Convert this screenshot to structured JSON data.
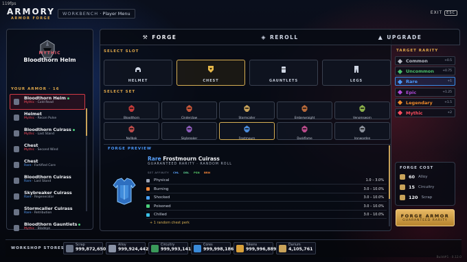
{
  "fps": "119fps",
  "app": {
    "title": "ARMORY",
    "subtitle": "ARMOR FORGE",
    "breadcrumb_root": "WORKBENCH",
    "breadcrumb_sep": "·",
    "breadcrumb_page": "Player Menu",
    "exit_label": "EXIT",
    "exit_key": "ESC"
  },
  "selected_item": {
    "rarity": "MYTHIC",
    "name": "Bloodthorn Helm",
    "icon": "helmet-icon"
  },
  "your_armor": {
    "label": "YOUR ARMOR · 16",
    "items": [
      {
        "name": "Bloodthorn Helm",
        "rarity": "Mythic",
        "perk": "Cold Read",
        "equipped": true,
        "selected": true
      },
      {
        "name": "Helmet",
        "rarity": "Mythic",
        "perk": "Recon Pulse",
        "equipped": false,
        "selected": false
      },
      {
        "name": "Bloodthorn Cuirass",
        "rarity": "Mythic",
        "perk": "Last Stand",
        "equipped": true,
        "selected": false
      },
      {
        "name": "Chest",
        "rarity": "Mythic",
        "perk": "Second Wind",
        "equipped": false,
        "selected": false
      },
      {
        "name": "Chest",
        "rarity": "Rare",
        "perk": "Fortified Core",
        "equipped": false,
        "selected": false
      },
      {
        "name": "Bloodthorn Cuirass",
        "rarity": "Rare",
        "perk": "Last Stand",
        "equipped": false,
        "selected": false
      },
      {
        "name": "Skybreaker Cuirass",
        "rarity": "Rare",
        "perk": "Regenerator",
        "equipped": false,
        "selected": false
      },
      {
        "name": "Stormcaller Cuirass",
        "rarity": "Rare",
        "perk": "Retribution",
        "equipped": false,
        "selected": false
      },
      {
        "name": "Bloodthorn Gauntlets",
        "rarity": "Mythic",
        "perk": "Bladeye",
        "equipped": true,
        "selected": false
      }
    ]
  },
  "tabs": [
    {
      "label": "FORGE",
      "icon": "hammer-icon",
      "active": true
    },
    {
      "label": "REROLL",
      "icon": "cube-icon",
      "active": false
    },
    {
      "label": "UPGRADE",
      "icon": "arrow-up-icon",
      "active": false
    }
  ],
  "select_slot": {
    "label": "SELECT SLOT",
    "slots": [
      {
        "label": "HELMET",
        "icon": "helmet-icon",
        "selected": false
      },
      {
        "label": "CHEST",
        "icon": "chest-icon",
        "selected": true
      },
      {
        "label": "GAUNTLETS",
        "icon": "gauntlets-icon",
        "selected": false
      },
      {
        "label": "LEGS",
        "icon": "legs-icon",
        "selected": false
      }
    ]
  },
  "select_set": {
    "label": "SELECT SET",
    "sets": [
      {
        "label": "Bloodthorn",
        "color": "#c23a3a",
        "selected": false
      },
      {
        "label": "Cinderclaw",
        "color": "#c7573a",
        "selected": false
      },
      {
        "label": "Stormcaller",
        "color": "#c9a35a",
        "selected": false
      },
      {
        "label": "Emberwraight",
        "color": "#b86a3a",
        "selected": false
      },
      {
        "label": "Venomsworn",
        "color": "#8bb04a",
        "selected": false
      },
      {
        "label": "Nullbak",
        "color": "#b84a4a",
        "selected": false
      },
      {
        "label": "Skybreaker",
        "color": "#8a5ab8",
        "selected": false
      },
      {
        "label": "Frostmourn",
        "color": "#4a8ad8",
        "selected": true
      },
      {
        "label": "Duskflame",
        "color": "#b84a8a",
        "selected": false
      },
      {
        "label": "Ironwarden",
        "color": "#8a8f9a",
        "selected": false
      }
    ]
  },
  "forge_preview": {
    "label": "FORGE PREVIEW",
    "rarity": "Rare",
    "name": "Frostmourn Cuirass",
    "guarantee": "GUARANTEED RARITY · RANDOM ROLL",
    "affinity_label": "SET AFFINITY",
    "affinities": [
      {
        "code": "CHL",
        "color": "#5aa3ff"
      },
      {
        "code": "DBL",
        "color": "#58c48a"
      },
      {
        "code": "PSN",
        "color": "#5ad06a"
      },
      {
        "code": "BRN",
        "color": "#ff8a3a"
      }
    ],
    "stats": [
      {
        "label": "Physical",
        "range": "1.0 – 3.0%",
        "color": "#9aa3b5"
      },
      {
        "label": "Burning",
        "range": "3.0 – 10.0%",
        "color": "#ff8a3a"
      },
      {
        "label": "Shocked",
        "range": "3.0 – 10.0%",
        "color": "#4aa3ff"
      },
      {
        "label": "Poisoned",
        "range": "3.0 – 10.0%",
        "color": "#4ad07a"
      },
      {
        "label": "Chilled",
        "range": "3.0 – 10.0%",
        "color": "#3ac0e6"
      }
    ],
    "perk": "+ 1 random chest perk"
  },
  "target_rarity": {
    "label": "TARGET RARITY",
    "options": [
      {
        "label": "Common",
        "pct": "+0.5",
        "color": "#b8bcc6",
        "selected": false
      },
      {
        "label": "Uncommon",
        "pct": "+0.75",
        "color": "#4ac06a",
        "selected": false
      },
      {
        "label": "Rare",
        "pct": "+1",
        "color": "#4a9aff",
        "selected": true
      },
      {
        "label": "Epic",
        "pct": "+1.25",
        "color": "#b04ad8",
        "selected": false
      },
      {
        "label": "Legendary",
        "pct": "+1.5",
        "color": "#f08a2a",
        "selected": false
      },
      {
        "label": "Mythic",
        "pct": "+2",
        "color": "#ff4d5e",
        "selected": false
      }
    ]
  },
  "forge_cost": {
    "label": "FORGE COST",
    "items": [
      {
        "amount": "60",
        "name": "Alloy",
        "color": "#c9a35a"
      },
      {
        "amount": "15",
        "name": "Circuitry",
        "color": "#c9a35a"
      },
      {
        "amount": "120",
        "name": "Scrap",
        "color": "#c9a35a"
      }
    ]
  },
  "forge_button": {
    "label": "FORGE ARMOR",
    "sub": "GUARANTEED RARITY"
  },
  "stores": {
    "label": "WORKSHOP STORES",
    "items": [
      {
        "name": "Scrap",
        "value": "999,872,650",
        "color": "#6a7386"
      },
      {
        "name": "Alloy",
        "value": "999,924,442",
        "color": "#8a93a6"
      },
      {
        "name": "Circuitry",
        "value": "999,993,141",
        "color": "#3a9a5a"
      },
      {
        "name": "Cores",
        "value": "999,998,186",
        "color": "#3a8ad8"
      },
      {
        "name": "Tokens",
        "value": "999,996,889",
        "color": "#d8a03a"
      },
      {
        "name": "Darium",
        "value": "4,105,761",
        "color": "#c9a35a"
      }
    ]
  },
  "build": "Build#1 · 0.12.0"
}
